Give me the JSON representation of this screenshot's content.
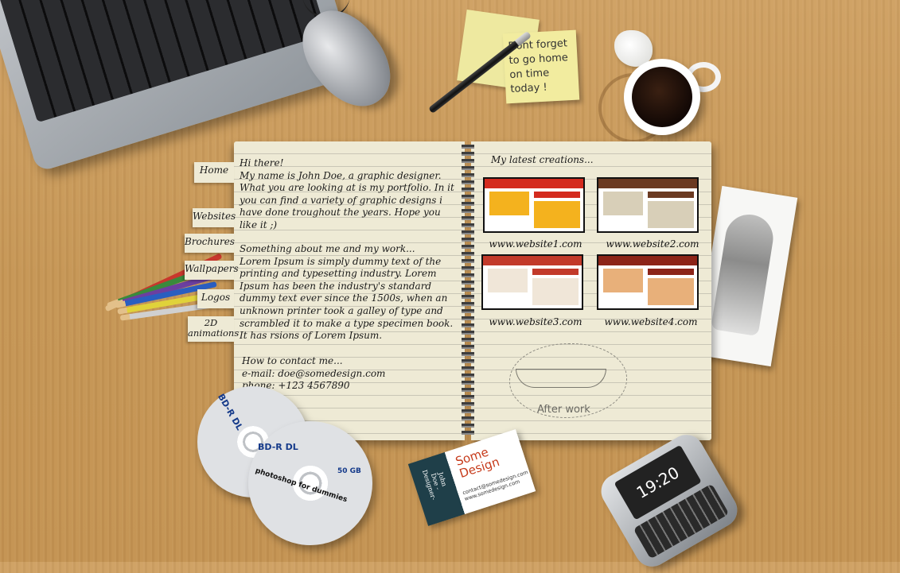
{
  "sticky_note": {
    "text": "Dont forget to go home on time today !"
  },
  "nav": {
    "home": "Home",
    "websites": "Websites",
    "brochures": "Brochures",
    "wallpapers": "Wallpapers",
    "logos": "Logos",
    "animations": "2D animations"
  },
  "intro": {
    "greeting": "Hi there!",
    "text": "My name is John Doe, a graphic designer. What you are looking at is my portfolio. In it you can find a variety of graphic designs i have done troughout the years. Hope you like it ;)"
  },
  "about": {
    "heading": "Something about me and my work...",
    "text": "Lorem Ipsum is simply dummy text of the printing and typesetting industry. Lorem Ipsum has been the industry's standard dummy text ever since the 1500s, when an unknown printer took a galley of type and scrambled it to make a type specimen book. It has rsions of Lorem Ipsum."
  },
  "contact": {
    "heading": "How to contact me...",
    "email": "e-mail: doe@somedesign.com",
    "phone": "phone: +123 4567890"
  },
  "creations": {
    "title": "My latest creations...",
    "items": [
      {
        "caption": "www.website1.com",
        "color": "#d42b1e",
        "accent": "#f4b21e"
      },
      {
        "caption": "www.website2.com",
        "color": "#6b3a22",
        "accent": "#d8cfb8"
      },
      {
        "caption": "www.website3.com",
        "color": "#c23a2a",
        "accent": "#f0e6d8"
      },
      {
        "caption": "www.website4.com",
        "color": "#8c2418",
        "accent": "#e8b07a"
      }
    ]
  },
  "doodle": {
    "text": "After work"
  },
  "discs": {
    "label1": "BD-R DL",
    "label2": "BD-R DL",
    "sub2": "photoshop for dummies",
    "cap2": "50 GB"
  },
  "card": {
    "name": "John Doe -Designer-",
    "brand": "Some Design",
    "email": "contact@somedesign.com",
    "web": "www.somedesign.com"
  },
  "phone_display": {
    "time": "19:20"
  }
}
